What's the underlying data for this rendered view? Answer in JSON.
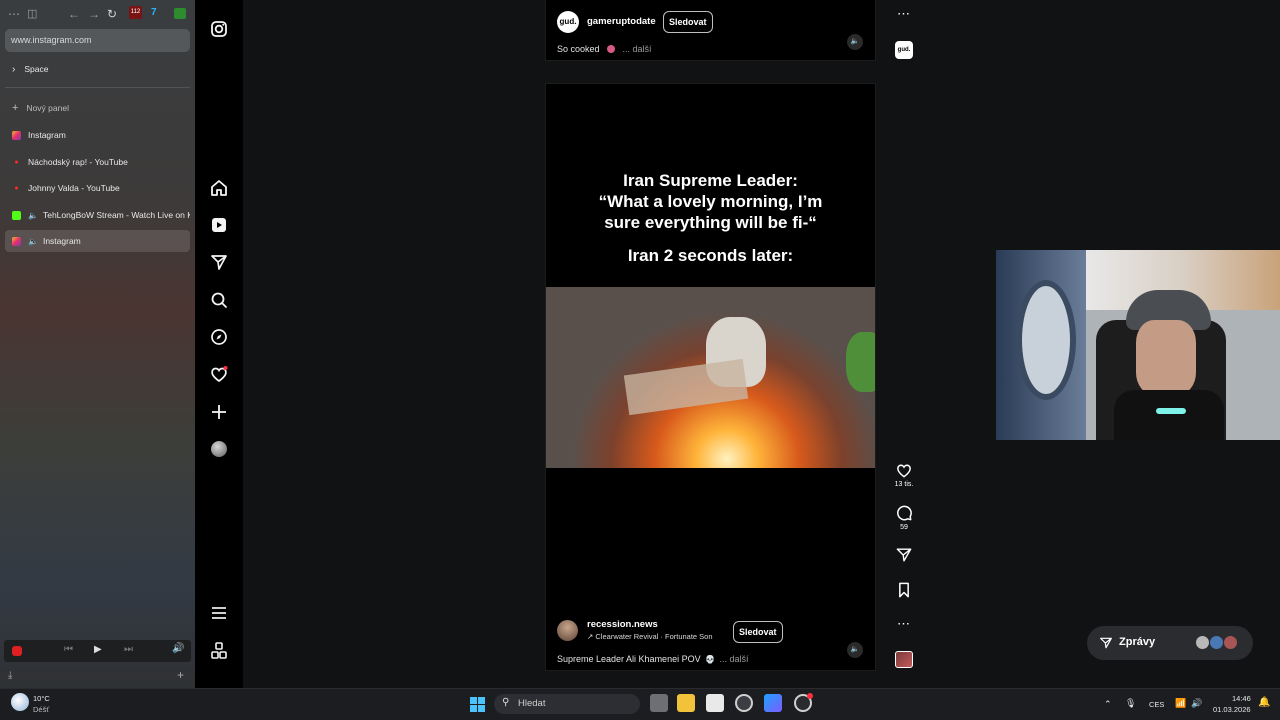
{
  "browser": {
    "url": "www.instagram.com",
    "space_label": "Space",
    "new_panel_label": "Nový panel",
    "extension_badge": "112",
    "tabs": [
      {
        "title": "Instagram",
        "favicon": "instagram-icon"
      },
      {
        "title": "Náchodský rap! - YouTube",
        "favicon": "youtube-icon"
      },
      {
        "title": "Johnny Valda - YouTube",
        "favicon": "youtube-icon"
      },
      {
        "title": "TehLongBoW Stream - Watch Live on Kick",
        "favicon": "kick-icon"
      },
      {
        "title": "Instagram",
        "favicon": "instagram-icon"
      }
    ]
  },
  "reels": {
    "top": {
      "avatar_text": "gud.",
      "username": "gameruptodate",
      "follow_label": "Sledovat",
      "caption": "So cooked",
      "more_label": "... další"
    },
    "current": {
      "overlay_line1": "Iran Supreme Leader:",
      "overlay_line2": "“What a lovely morning, I’m",
      "overlay_line3": "sure everything will be fi-“",
      "overlay_line4": "Iran 2 seconds later:",
      "username": "recession.news",
      "audio": "Clearwater Revival · Fortunate Son",
      "follow_label": "Sledovat",
      "caption": "Supreme Leader Ali Khamenei POV",
      "more_label": "... další"
    },
    "top_side_avatar": "gud.",
    "likes": "13 tis.",
    "comments": "59"
  },
  "messages": {
    "label": "Zprávy"
  },
  "taskbar": {
    "weather_temp": "10°C",
    "weather_desc": "Déšť",
    "search_placeholder": "Hledat",
    "language": "CES",
    "time": "14:46",
    "date": "01.03.2026"
  },
  "colors": {
    "instagram_accent": "#e1306c",
    "kick_green": "#53fc18",
    "youtube_red": "#ff0000",
    "notification_dot": "#ff3040"
  }
}
